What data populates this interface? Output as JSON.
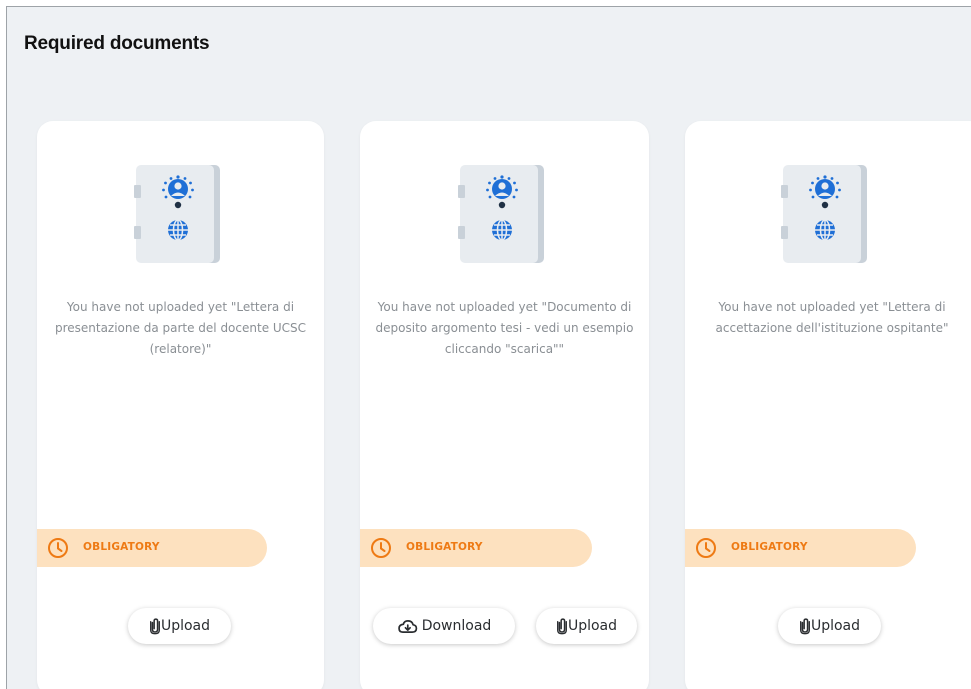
{
  "page": {
    "title": "Required documents"
  },
  "cards": [
    {
      "message": "You have not uploaded yet \"Lettera di presentazione da parte del docente UCSC (relatore)\"",
      "badge": "OBLIGATORY",
      "upload_label": "Upload"
    },
    {
      "message": "You have not uploaded yet \"Documento di deposito argomento tesi - vedi un esempio cliccando \"scarica\"\"",
      "badge": "OBLIGATORY",
      "download_label": "Download",
      "upload_label": "Upload"
    },
    {
      "message": "You have not uploaded yet \"Lettera di accettazione dell'istituzione ospitante\"",
      "badge": "OBLIGATORY",
      "upload_label": "Upload"
    }
  ],
  "icons": {
    "document": "passport-document-icon",
    "badge": "clock-icon",
    "upload": "paperclip-icon",
    "download": "cloud-download-icon"
  },
  "colors": {
    "badge_background": "#fde1bf",
    "badge_text": "#ee7a14",
    "page_background": "#eef1f4",
    "document_blue": "#1f6fd6"
  }
}
